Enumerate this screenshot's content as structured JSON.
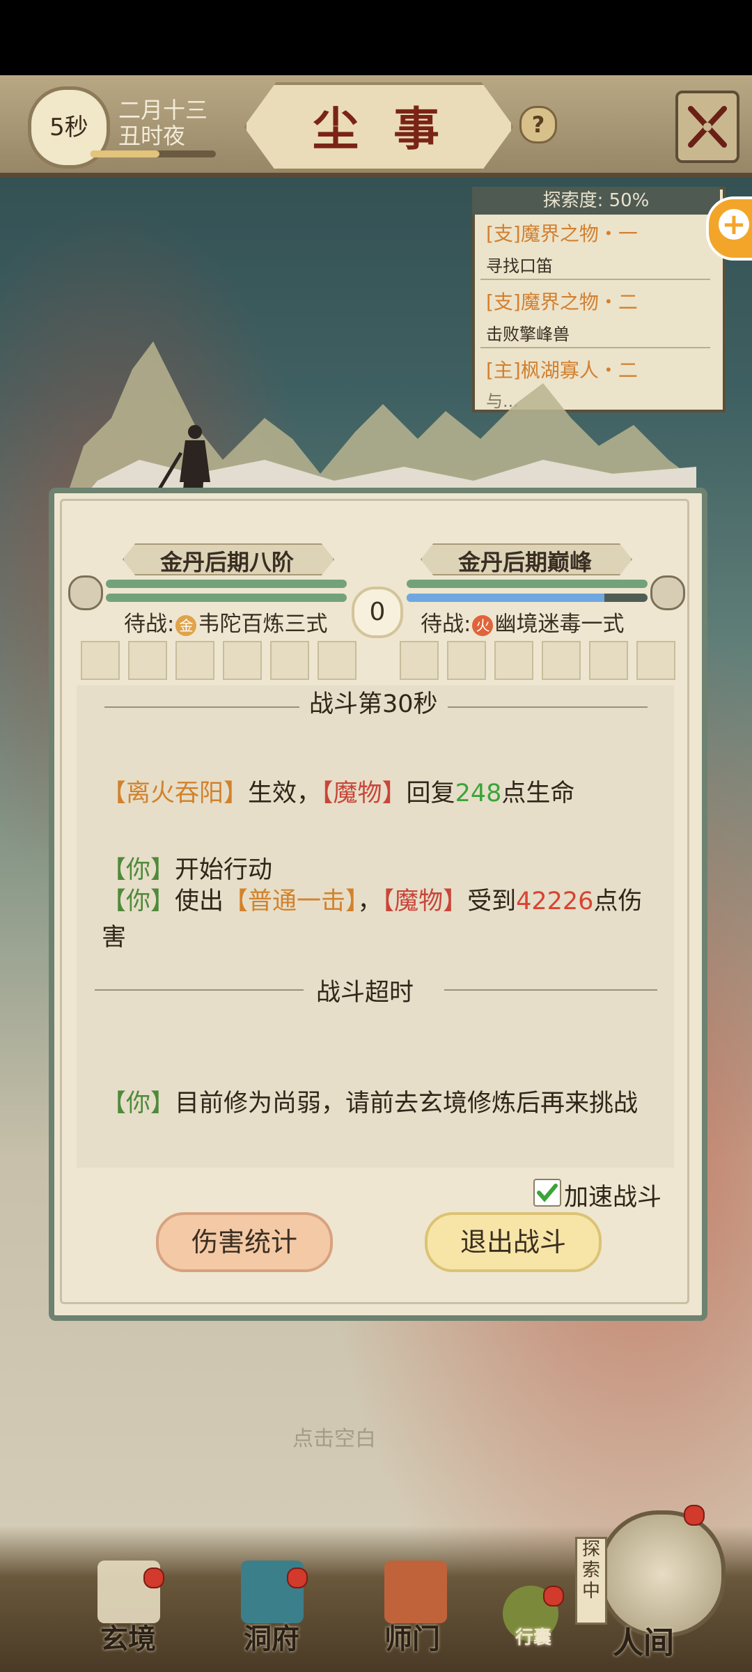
{
  "header": {
    "timer": "5秒",
    "date_line1": "二月十三",
    "date_line2": "丑时夜",
    "time_progress": 0.55,
    "title": "尘事",
    "help": "?"
  },
  "quest_panel": {
    "progress_label": "探索度: 50%",
    "quests": [
      {
        "title": "[支]魔界之物・一",
        "desc": "寻找口笛"
      },
      {
        "title": "[支]魔界之物・二",
        "desc": "击败擎峰兽"
      },
      {
        "title": "[主]枫湖寡人・二",
        "desc": "与..."
      }
    ]
  },
  "battle": {
    "player_rank": "金丹后期八阶",
    "enemy_rank": "金丹后期巅峰",
    "score": "0",
    "player_hp": 1.0,
    "player_mp": 1.0,
    "enemy_hp": 1.0,
    "enemy_mp": 0.82,
    "player_wait": {
      "prefix": "待战:",
      "element": "金",
      "skill": "韦陀百炼三式"
    },
    "enemy_wait": {
      "prefix": "待战:",
      "element": "火",
      "skill": "幽境迷毒一式"
    },
    "log": {
      "section_title": "战斗第30秒",
      "line1": {
        "skill": "【离火吞阳】",
        "text1": "生效，",
        "target": "【魔物】",
        "text2": "回复",
        "value": "248",
        "text3": "点生命"
      },
      "line2": {
        "actor": "【你】",
        "text": "开始行动"
      },
      "line3": {
        "actor": "【你】",
        "text1": "使出",
        "skill": "【普通一击】",
        "text2": "，",
        "target": "【魔物】",
        "text3": "受到",
        "value": "42226",
        "text4": "点伤害"
      },
      "timeout": "战斗超时",
      "line4": {
        "actor": "【你】",
        "text": "目前修为尚弱，请前去玄境修炼后再来挑战"
      }
    },
    "accelerate_label": "加速战斗",
    "accelerate_checked": true,
    "damage_stats_label": "伤害统计",
    "exit_label": "退出战斗"
  },
  "hint": "点击空白",
  "nav": {
    "items": [
      "玄境",
      "洞府",
      "师门",
      "行囊",
      "人间"
    ],
    "explore_tag": "探索中"
  },
  "colors": {
    "accent_orange": "#d2822c",
    "you_green": "#4f8a3a",
    "monster_red": "#c9453a",
    "heal_green": "#3aa43a",
    "damage_red": "#d94332"
  }
}
